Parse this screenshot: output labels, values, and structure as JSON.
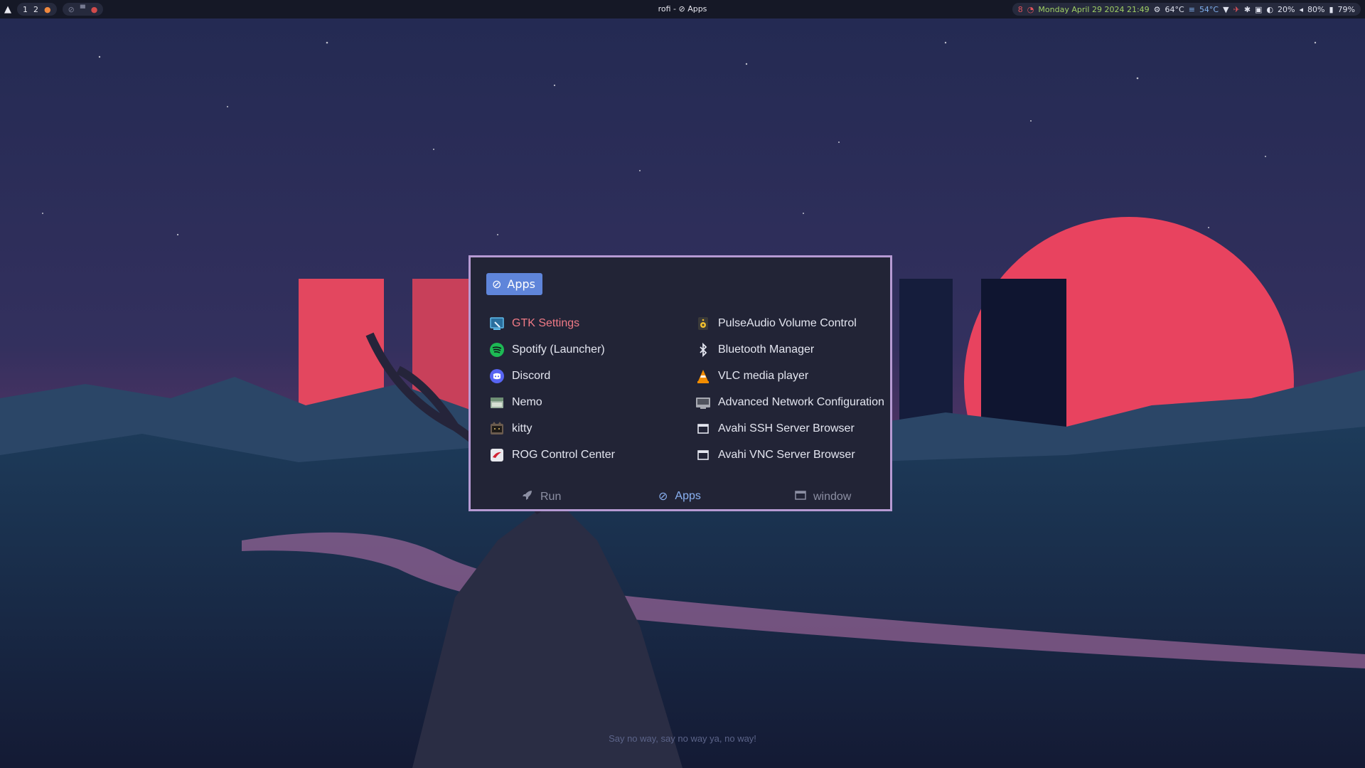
{
  "topbar": {
    "workspaces": [
      "1",
      "2"
    ],
    "window_title": "rofi - ⊘ Apps",
    "status": {
      "notifications": "8",
      "datetime": "Monday April 29 2024  21:49",
      "cpu_temp": "64°C",
      "gpu_temp": "54°C",
      "brightness": "20%",
      "volume": "80%",
      "battery": "79%"
    }
  },
  "rofi": {
    "prompt": "Apps",
    "left_items": [
      {
        "label": "GTK Settings",
        "icon": "gtk-settings-icon"
      },
      {
        "label": "Spotify (Launcher)",
        "icon": "spotify-icon"
      },
      {
        "label": "Discord",
        "icon": "discord-icon"
      },
      {
        "label": "Nemo",
        "icon": "nemo-folder-icon"
      },
      {
        "label": "kitty",
        "icon": "kitty-icon"
      },
      {
        "label": "ROG Control Center",
        "icon": "rog-icon"
      }
    ],
    "right_items": [
      {
        "label": "PulseAudio Volume Control",
        "icon": "speaker-icon"
      },
      {
        "label": "Bluetooth Manager",
        "icon": "bluetooth-icon"
      },
      {
        "label": "VLC media player",
        "icon": "vlc-cone-icon"
      },
      {
        "label": "Advanced Network Configuration",
        "icon": "network-icon"
      },
      {
        "label": "Avahi SSH Server Browser",
        "icon": "window-icon"
      },
      {
        "label": "Avahi VNC Server Browser",
        "icon": "window-icon"
      }
    ],
    "modes": [
      {
        "label": "Run",
        "icon": "rocket-icon",
        "active": false
      },
      {
        "label": "Apps",
        "icon": "apps-icon",
        "active": true
      },
      {
        "label": "window",
        "icon": "window-icon",
        "active": false
      }
    ],
    "selected": "GTK Settings"
  },
  "tagline": "Say no way, say no way ya, no way!",
  "colors": {
    "accent": "#5f85da",
    "border": "#b69ad3",
    "selected_text": "#f07a86",
    "sun": "#e8435f"
  }
}
